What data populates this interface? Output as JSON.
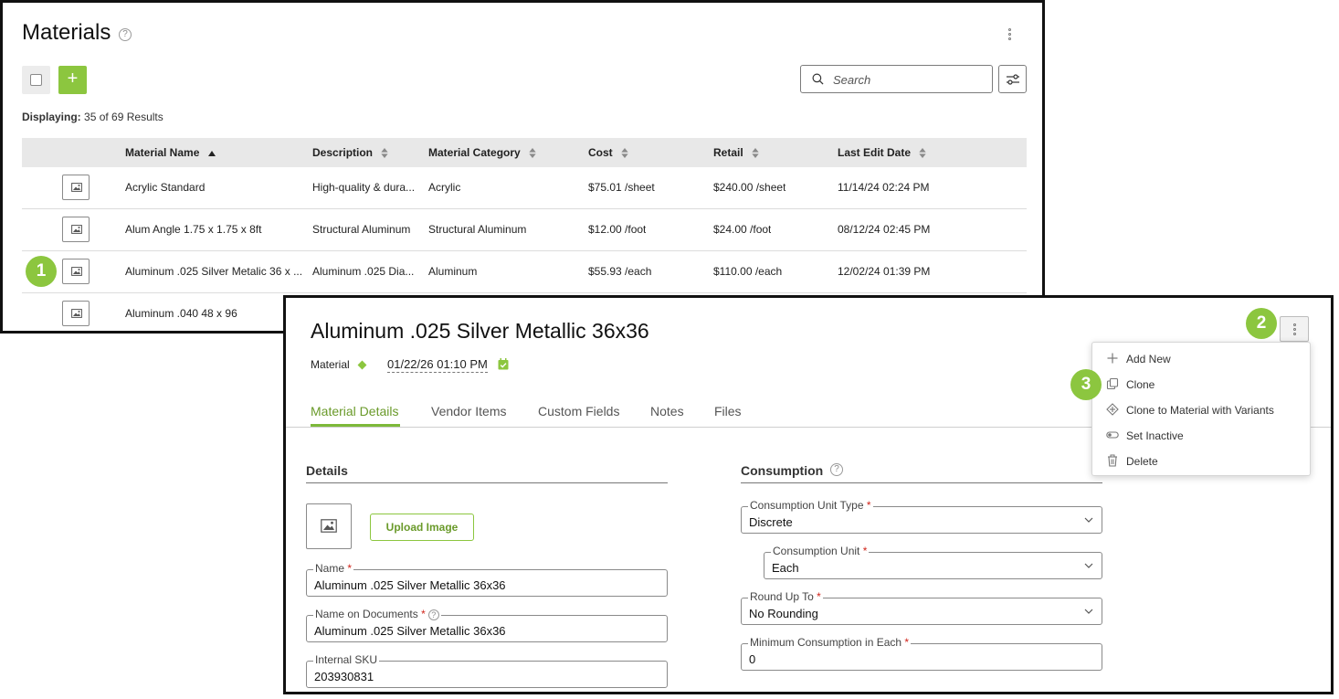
{
  "list": {
    "title": "Materials",
    "help_glyph": "?",
    "add_glyph": "+",
    "search_placeholder": "Search",
    "displaying_label": "Displaying:",
    "displaying_value": "35 of 69 Results",
    "columns": [
      "Material Name",
      "Description",
      "Material Category",
      "Cost",
      "Retail",
      "Last Edit Date"
    ],
    "rows": [
      {
        "name": "Acrylic Standard",
        "description": "High-quality & dura...",
        "category": "Acrylic",
        "cost": "$75.01 /sheet",
        "retail": "$240.00 /sheet",
        "date": "11/14/24 02:24 PM"
      },
      {
        "name": "Alum Angle 1.75 x 1.75 x 8ft",
        "description": "Structural Aluminum",
        "category": "Structural Aluminum",
        "cost": "$12.00 /foot",
        "retail": "$24.00 /foot",
        "date": "08/12/24 02:45 PM"
      },
      {
        "name": "Aluminum .025 Silver Metalic 36 x ...",
        "description": "Aluminum .025 Dia...",
        "category": "Aluminum",
        "cost": "$55.93 /each",
        "retail": "$110.00 /each",
        "date": "12/02/24 01:39 PM"
      },
      {
        "name": "Aluminum .040 48 x 96",
        "description": "",
        "category": "",
        "cost": "",
        "retail": "",
        "date": ""
      }
    ]
  },
  "callouts": [
    "1",
    "2",
    "3"
  ],
  "detail": {
    "title": "Aluminum .025 Silver Metallic 36x36",
    "type_label": "Material",
    "date": "01/22/26 01:10 PM",
    "tabs": [
      "Material Details",
      "Vendor Items",
      "Custom Fields",
      "Notes",
      "Files"
    ],
    "details_section": "Details",
    "consumption_section": "Consumption",
    "upload_label": "Upload Image",
    "required_mark": "*",
    "fields": {
      "name": {
        "label": "Name",
        "value": "Aluminum .025 Silver Metallic 36x36"
      },
      "name_on_docs": {
        "label": "Name on Documents",
        "value": "Aluminum .025 Silver Metallic 36x36"
      },
      "sku": {
        "label": "Internal SKU",
        "value": "203930831"
      },
      "consumption_unit_type": {
        "label": "Consumption Unit Type",
        "value": "Discrete"
      },
      "consumption_unit": {
        "label": "Consumption Unit",
        "value": "Each"
      },
      "round_up_to": {
        "label": "Round Up To",
        "value": "No Rounding"
      },
      "min_consumption": {
        "label": "Minimum Consumption in Each",
        "value": "0"
      }
    },
    "menu": [
      "Add New",
      "Clone",
      "Clone to Material with Variants",
      "Set Inactive",
      "Delete"
    ]
  },
  "colors": {
    "accent": "#8cc63f",
    "accent_text": "#6a9a2a",
    "required": "#d0241a"
  }
}
